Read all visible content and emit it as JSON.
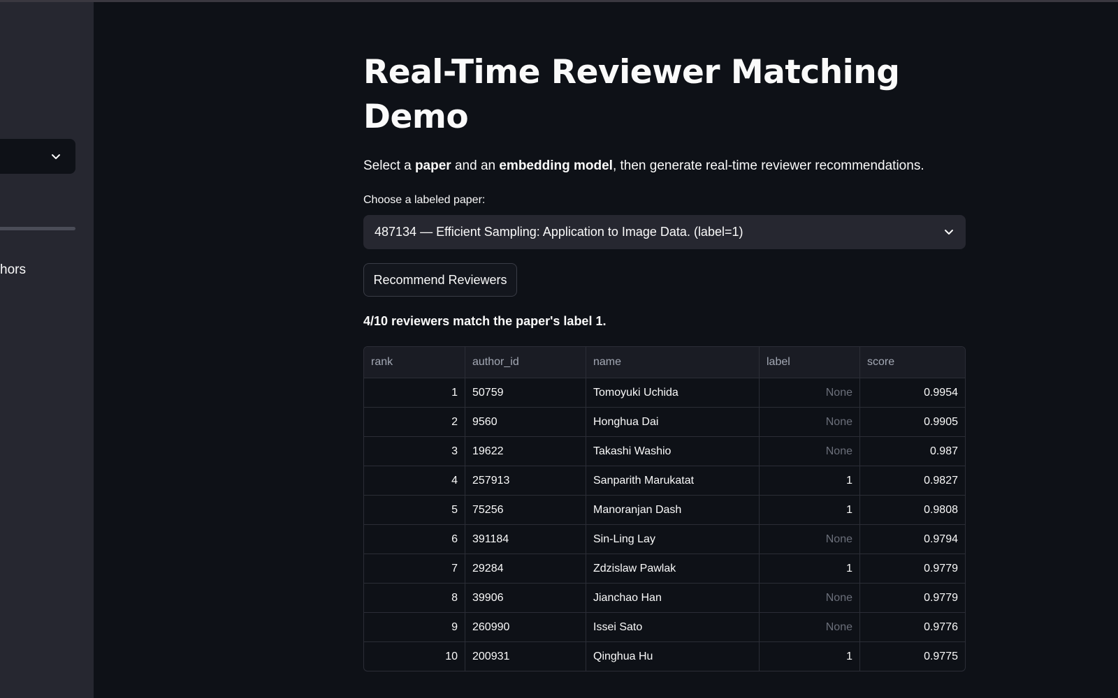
{
  "sidebar": {
    "partial_text": "hors"
  },
  "main": {
    "title": "Real-Time Reviewer Matching Demo",
    "intro": {
      "part1": "Select a ",
      "bold1": "paper",
      "part2": " and an ",
      "bold2": "embedding model",
      "part3": ", then generate real-time reviewer recommendations."
    },
    "paper_select": {
      "label": "Choose a labeled paper:",
      "value": "487134 — Efficient Sampling: Application to Image Data. (label=1)"
    },
    "recommend_button_label": "Recommend Reviewers",
    "summary": "4/10 reviewers match the paper's label 1."
  },
  "table": {
    "columns": [
      "rank",
      "author_id",
      "name",
      "label",
      "score"
    ],
    "rows": [
      {
        "rank": "1",
        "author_id": "50759",
        "name": "Tomoyuki Uchida",
        "label": "None",
        "score": "0.9954"
      },
      {
        "rank": "2",
        "author_id": "9560",
        "name": "Honghua Dai",
        "label": "None",
        "score": "0.9905"
      },
      {
        "rank": "3",
        "author_id": "19622",
        "name": "Takashi Washio",
        "label": "None",
        "score": "0.987"
      },
      {
        "rank": "4",
        "author_id": "257913",
        "name": "Sanparith Marukatat",
        "label": "1",
        "score": "0.9827"
      },
      {
        "rank": "5",
        "author_id": "75256",
        "name": "Manoranjan Dash",
        "label": "1",
        "score": "0.9808"
      },
      {
        "rank": "6",
        "author_id": "391184",
        "name": "Sin-Ling Lay",
        "label": "None",
        "score": "0.9794"
      },
      {
        "rank": "7",
        "author_id": "29284",
        "name": "Zdzislaw Pawlak",
        "label": "1",
        "score": "0.9779"
      },
      {
        "rank": "8",
        "author_id": "39906",
        "name": "Jianchao Han",
        "label": "None",
        "score": "0.9779"
      },
      {
        "rank": "9",
        "author_id": "260990",
        "name": "Issei Sato",
        "label": "None",
        "score": "0.9776"
      },
      {
        "rank": "10",
        "author_id": "200931",
        "name": "Qinghua Hu",
        "label": "1",
        "score": "0.9775"
      }
    ]
  },
  "icons": {
    "sidebar_select": "chevron-down-icon",
    "paper_select": "chevron-down-icon"
  },
  "colors": {
    "background": "#0e1117",
    "sidebar": "#262730",
    "select_bg": "#262730",
    "muted_text": "#6b6f7a"
  }
}
